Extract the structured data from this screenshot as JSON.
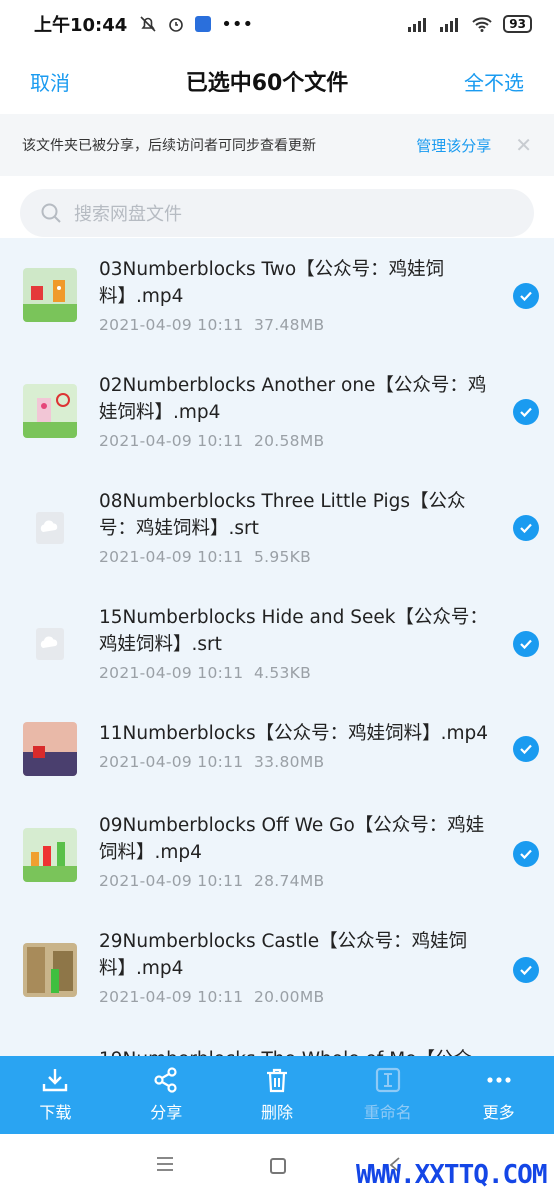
{
  "status_bar": {
    "time": "上午10:44",
    "battery": "93"
  },
  "header": {
    "cancel": "取消",
    "title": "已选中60个文件",
    "deselect_all": "全不选"
  },
  "notice": {
    "text": "该文件夹已被分享，后续访问者可同步查看更新",
    "manage": "管理该分享",
    "close": "✕"
  },
  "search": {
    "placeholder": "搜索网盘文件"
  },
  "files": [
    {
      "name": "03Numberblocks Two【公众号：鸡娃饲料】.mp4",
      "date": "2021-04-09  10:11",
      "size": "37.48MB",
      "kind": "video"
    },
    {
      "name": "02Numberblocks Another one【公众号：鸡娃饲料】.mp4",
      "date": "2021-04-09  10:11",
      "size": "20.58MB",
      "kind": "video"
    },
    {
      "name": "08Numberblocks Three Little Pigs【公众号：鸡娃饲料】.srt",
      "date": "2021-04-09  10:11",
      "size": "5.95KB",
      "kind": "file"
    },
    {
      "name": "15Numberblocks Hide and Seek【公众号：鸡娃饲料】.srt",
      "date": "2021-04-09  10:11",
      "size": "4.53KB",
      "kind": "file"
    },
    {
      "name": "11Numberblocks【公众号：鸡娃饲料】.mp4",
      "date": "2021-04-09  10:11",
      "size": "33.80MB",
      "kind": "video"
    },
    {
      "name": "09Numberblocks Off We Go【公众号：鸡娃饲料】.mp4",
      "date": "2021-04-09  10:11",
      "size": "28.74MB",
      "kind": "video"
    },
    {
      "name": "29Numberblocks Castle【公众号：鸡娃饲料】.mp4",
      "date": "2021-04-09  10:11",
      "size": "20.00MB",
      "kind": "video"
    }
  ],
  "partial_row": "19Numberblocks The Whole of Me【公众",
  "toolbar": {
    "download": "下载",
    "share": "分享",
    "delete": "删除",
    "rename": "重命名",
    "more": "更多"
  },
  "watermark": "WWW.XXTTQ.COM",
  "colors": {
    "accent": "#1a9bf0",
    "toolbar": "#2aa4f2",
    "list_bg": "#eef5fb"
  }
}
